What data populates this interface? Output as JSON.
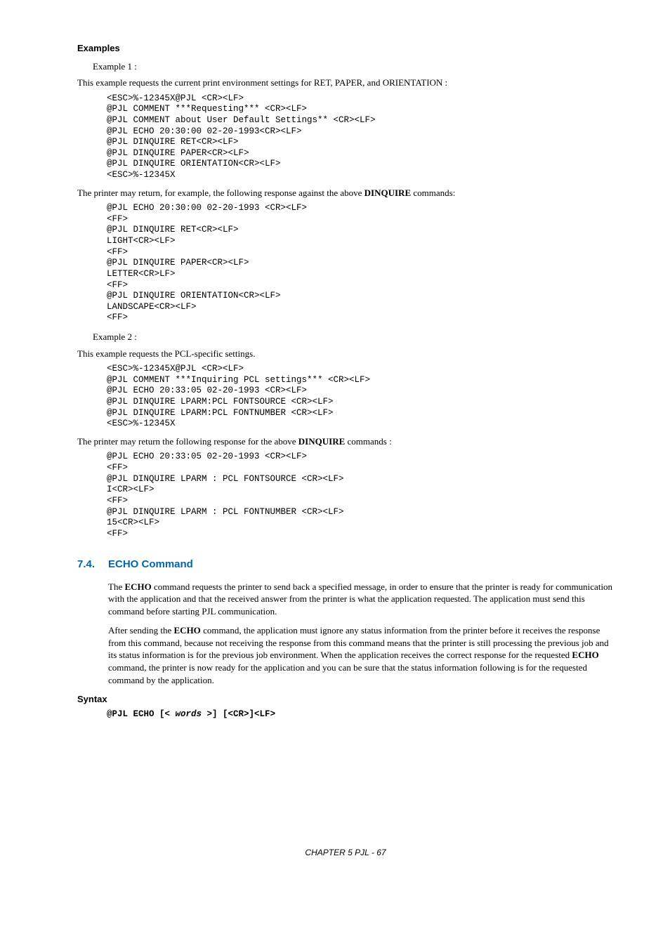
{
  "examples_heading": "Examples",
  "example1_label": "Example 1 :",
  "example1_intro": "This example requests the current print environment settings for RET, PAPER, and ORIENTATION :",
  "code1": "<ESC>%-12345X@PJL <CR><LF>\n@PJL COMMENT ***Requesting*** <CR><LF>\n@PJL COMMENT about User Default Settings** <CR><LF>\n@PJL ECHO 20:30:00 02-20-1993<CR><LF>\n@PJL DINQUIRE RET<CR><LF>\n@PJL DINQUIRE PAPER<CR><LF>\n@PJL DINQUIRE ORIENTATION<CR><LF>\n<ESC>%-12345X",
  "example1_response_intro_pre": "The printer may return, for example, the following response against the above ",
  "example1_response_intro_bold": "DINQUIRE",
  "example1_response_intro_post": " commands:",
  "code2": "@PJL ECHO 20:30:00 02-20-1993 <CR><LF>\n<FF>\n@PJL DINQUIRE RET<CR><LF>\nLIGHT<CR><LF>\n<FF>\n@PJL DINQUIRE PAPER<CR><LF>\nLETTER<CR>LF>\n<FF>\n@PJL DINQUIRE ORIENTATION<CR><LF>\nLANDSCAPE<CR><LF>\n<FF>",
  "example2_label": "Example 2 :",
  "example2_intro": "This example requests the PCL-specific settings.",
  "code3": "<ESC>%-12345X@PJL <CR><LF>\n@PJL COMMENT ***Inquiring PCL settings*** <CR><LF>\n@PJL ECHO 20:33:05 02-20-1993 <CR><LF>\n@PJL DINQUIRE LPARM:PCL FONTSOURCE <CR><LF>\n@PJL DINQUIRE LPARM:PCL FONTNUMBER <CR><LF>\n<ESC>%-12345X",
  "example2_response_intro_pre": "The printer may return the following response for the above ",
  "example2_response_intro_bold": "DINQUIRE",
  "example2_response_intro_post": " commands :",
  "code4": "@PJL ECHO 20:33:05 02-20-1993 <CR><LF>\n<FF>\n@PJL DINQUIRE LPARM : PCL FONTSOURCE <CR><LF>\nI<CR><LF>\n<FF>\n@PJL DINQUIRE LPARM : PCL FONTNUMBER <CR><LF>\n15<CR><LF>\n<FF>",
  "section_num": "7.4.",
  "section_title": "ECHO Command",
  "echo_para1_pre": "The ",
  "echo_para1_bold": "ECHO",
  "echo_para1_post": " command requests the printer to send back a specified message,  in order to ensure that the printer is ready for communication with the application and that the received answer from the printer is what the application requested.  The application must send this command before starting PJL communication.",
  "echo_para2_pre": "After sending the ",
  "echo_para2_bold1": "ECHO",
  "echo_para2_mid": " command, the application must ignore any status information from the printer before it receives the response from this command, because not receiving the response from this command means that the printer is still processing the previous job and its status information is for the previous job environment.  When the application receives the correct response for the requested ",
  "echo_para2_bold2": "ECHO",
  "echo_para2_post": " command, the printer is now ready for the application and you can be sure that the status information following is for the requested command by the application.",
  "syntax_heading": "Syntax",
  "syntax_pre": "@PJL ECHO [< ",
  "syntax_italic": "words",
  "syntax_post": " >] [<CR>]<LF>",
  "footer": "CHAPTER 5 PJL - 67"
}
